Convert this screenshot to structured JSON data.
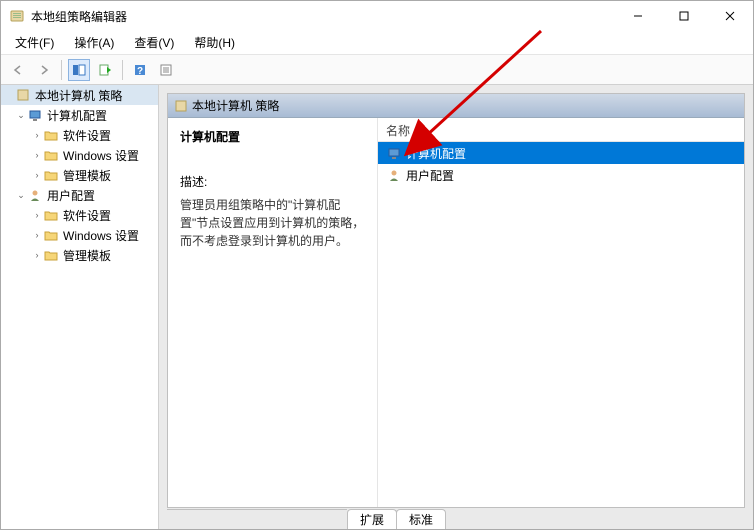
{
  "window": {
    "title": "本地组策略编辑器"
  },
  "menus": {
    "file": "文件(F)",
    "action": "操作(A)",
    "view": "查看(V)",
    "help": "帮助(H)"
  },
  "tree": {
    "root": "本地计算机 策略",
    "computer": "计算机配置",
    "user": "用户配置",
    "software": "软件设置",
    "windows": "Windows 设置",
    "templates": "管理模板"
  },
  "content": {
    "header": "本地计算机 策略",
    "sectionTitle": "计算机配置",
    "descLabel": "描述:",
    "descText": "管理员用组策略中的\"计算机配置\"节点设置应用到计算机的策略，而不考虑登录到计算机的用户。"
  },
  "list": {
    "columnHeader": "名称",
    "items": [
      {
        "label": "计算机配置",
        "icon": "pc",
        "selected": true
      },
      {
        "label": "用户配置",
        "icon": "user",
        "selected": false
      }
    ]
  },
  "tabs": {
    "extended": "扩展",
    "standard": "标准"
  }
}
